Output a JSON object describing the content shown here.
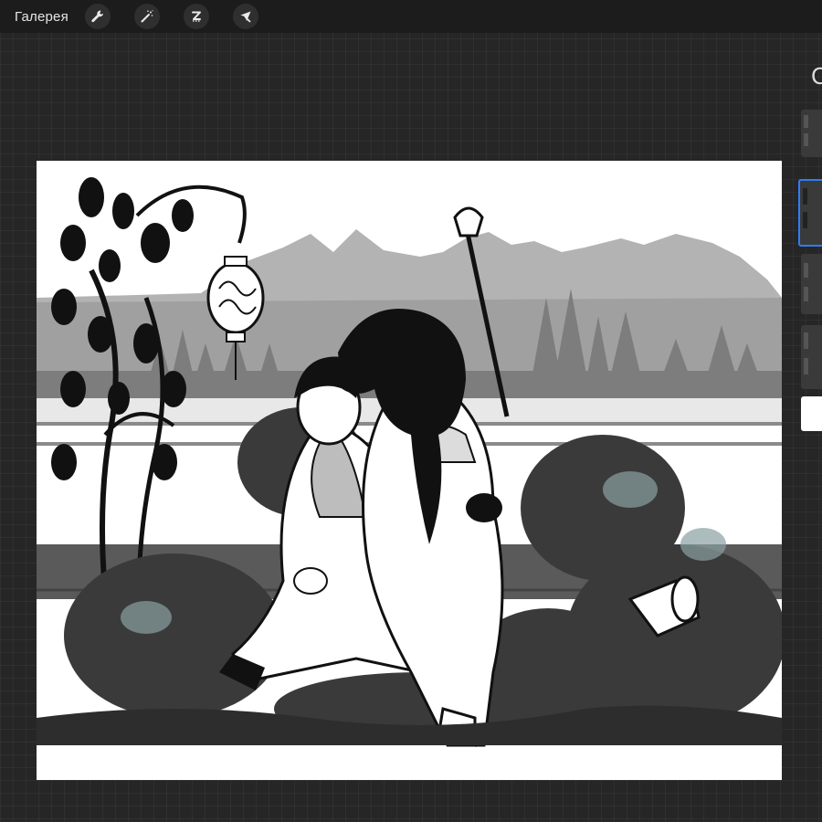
{
  "topbar": {
    "gallery_label": "Галерея",
    "tools": [
      {
        "name": "wrench-icon",
        "label": "actions"
      },
      {
        "name": "magic-wand-icon",
        "label": "adjustments"
      },
      {
        "name": "selection-s-icon",
        "label": "selection"
      },
      {
        "name": "arrow-cursor-icon",
        "label": "transform"
      }
    ]
  },
  "right_panel": {
    "partial_glyph": "C",
    "layer_count": 5,
    "selected_layer_index": 1
  },
  "colors": {
    "background": "#262626",
    "topbar": "#1c1c1c",
    "accent_selected": "#2f7cf6",
    "canvas": "#ffffff"
  },
  "canvas": {
    "content": "artwork"
  }
}
